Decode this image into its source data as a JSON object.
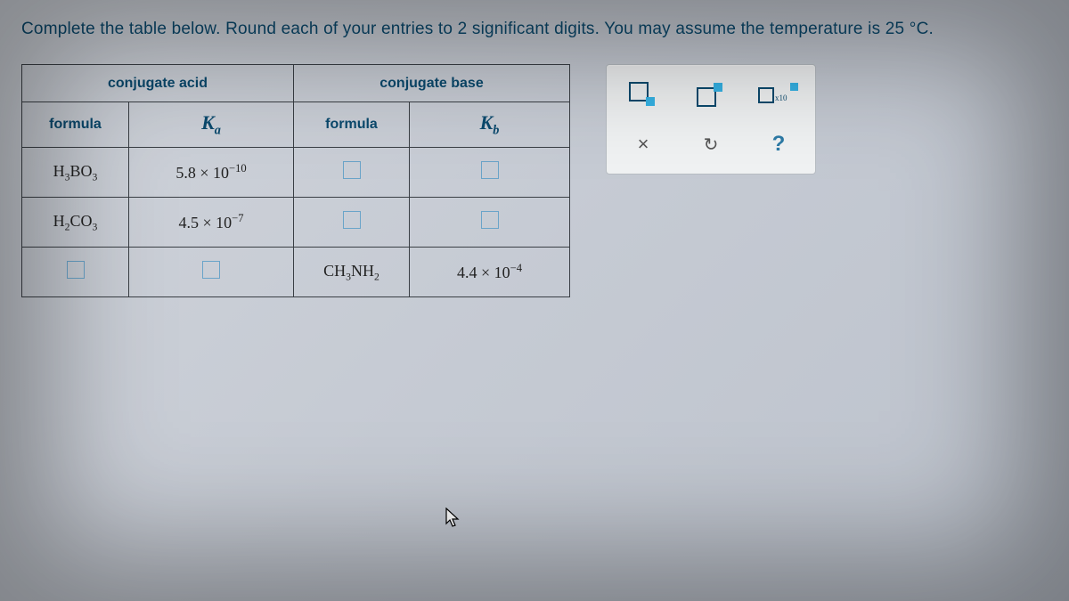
{
  "instruction": "Complete the table below. Round each of your entries to 2 significant digits. You may assume the temperature is 25 °C.",
  "headers": {
    "acid_group": "conjugate acid",
    "base_group": "conjugate base",
    "formula": "formula",
    "ka_main": "K",
    "ka_sub": "a",
    "kb_main": "K",
    "kb_sub": "b"
  },
  "rows": [
    {
      "acid_formula_html": "H<sub>3</sub>BO<sub>3</sub>",
      "ka_html": "5.8 × 10<sup>−10</sup>",
      "base_formula_html": "□",
      "kb_html": "□"
    },
    {
      "acid_formula_html": "H<sub>2</sub>CO<sub>3</sub>",
      "ka_html": "4.5 × 10<sup>−7</sup>",
      "base_formula_html": "□",
      "kb_html": "□"
    },
    {
      "acid_formula_html": "□",
      "ka_html": "□",
      "base_formula_html": "CH<sub>3</sub>NH<sub>2</sub>",
      "kb_html": "4.4 × 10<sup>−4</sup>"
    }
  ],
  "toolbox": {
    "t1": "subscript-template",
    "t2": "superscript-template",
    "t3": "sci-notation-template",
    "t4": "×",
    "t5": "↻",
    "t6": "?"
  }
}
